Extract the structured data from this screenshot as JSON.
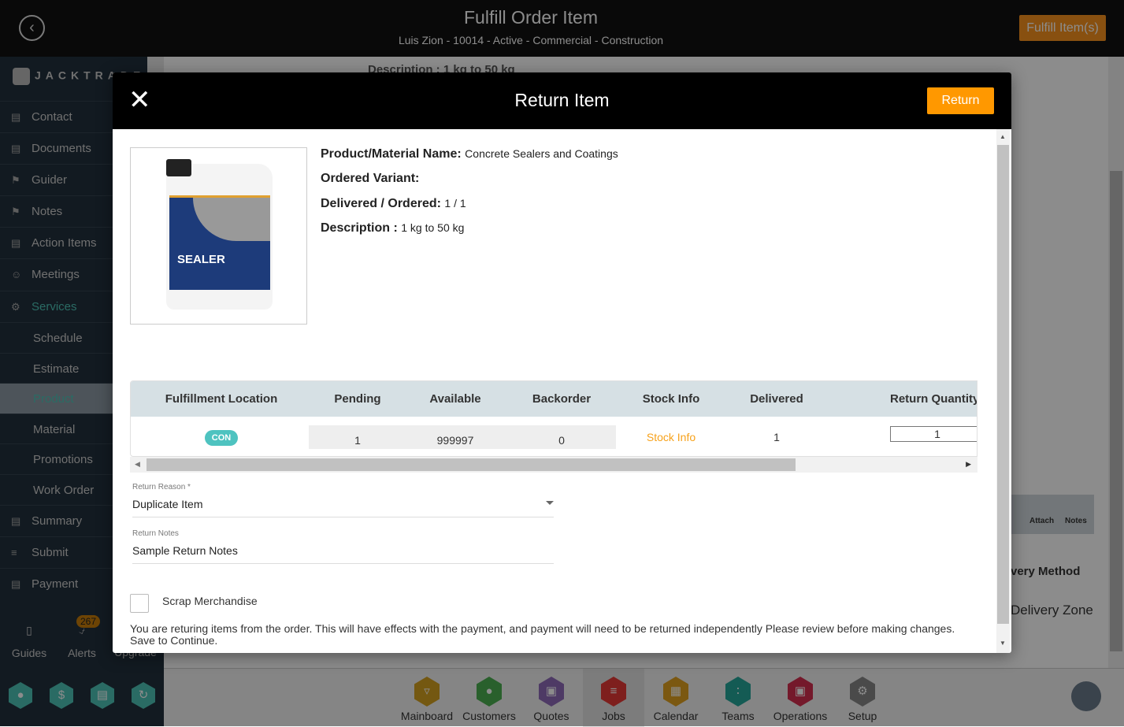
{
  "header": {
    "title": "Fulfill Order Item",
    "subtitle": "Luis Zion - 10014 - Active - Commercial - Construction",
    "fulfill_button": "Fulfill Item(s)"
  },
  "sidebar": {
    "logo": "JACKTRADE",
    "items": [
      {
        "label": "Contact",
        "icon": "contact-book-icon"
      },
      {
        "label": "Documents",
        "icon": "document-icon"
      },
      {
        "label": "Guider",
        "icon": "signpost-icon"
      },
      {
        "label": "Notes",
        "icon": "signpost-icon"
      },
      {
        "label": "Action Items",
        "icon": "clipboard-icon"
      },
      {
        "label": "Meetings",
        "icon": "meeting-icon"
      },
      {
        "label": "Services",
        "icon": "services-icon",
        "active": true
      },
      {
        "label": "Schedule"
      },
      {
        "label": "Estimate"
      },
      {
        "label": "Product",
        "selected": true
      },
      {
        "label": "Material"
      },
      {
        "label": "Promotions"
      },
      {
        "label": "Work Order"
      },
      {
        "label": "Summary",
        "icon": "summary-icon"
      },
      {
        "label": "Submit",
        "icon": "submit-icon"
      },
      {
        "label": "Payment",
        "icon": "payment-icon"
      }
    ],
    "bottom": {
      "guides": "Guides",
      "alerts": "Alerts",
      "alerts_count": "267",
      "upgrade": "Upgrade"
    }
  },
  "background": {
    "description": "Description : 1 kg to 50 kg",
    "attach": "Attach",
    "notes": "Notes",
    "delivery_method": "very Method",
    "delivery_zone": "Delivery Zone"
  },
  "bottom_nav": [
    {
      "label": "Mainboard",
      "color": "#d4a020"
    },
    {
      "label": "Customers",
      "color": "#4caf50"
    },
    {
      "label": "Quotes",
      "color": "#8e6bb8"
    },
    {
      "label": "Jobs",
      "color": "#e53935",
      "selected": true
    },
    {
      "label": "Calendar",
      "color": "#e0a020"
    },
    {
      "label": "Teams",
      "color": "#26a69a"
    },
    {
      "label": "Operations",
      "color": "#d32f4f"
    },
    {
      "label": "Setup",
      "color": "#888888"
    }
  ],
  "modal": {
    "title": "Return Item",
    "return_button": "Return",
    "product": {
      "name_label": "Product/Material Name:",
      "name": "Concrete Sealers and Coatings",
      "variant_label": "Ordered Variant:",
      "variant": "",
      "delivered_label": "Delivered / Ordered:",
      "delivered": "1 / 1",
      "description_label": "Description :",
      "description": "1 kg to 50 kg",
      "image_text": "Concrete SEALER"
    },
    "table": {
      "headers": [
        "Fulfillment Location",
        "Pending",
        "Available",
        "Backorder",
        "Stock Info",
        "Delivered",
        "Return Quantity"
      ],
      "row": {
        "location": "CON",
        "pending": "1",
        "available": "999997",
        "backorder": "0",
        "stock_info": "Stock Info",
        "delivered": "1",
        "return_quantity": "1"
      }
    },
    "return_reason": {
      "label": "Return Reason *",
      "value": "Duplicate Item"
    },
    "return_notes": {
      "label": "Return Notes",
      "value": "Sample Return Notes"
    },
    "scrap": {
      "label": "Scrap Merchandise",
      "checked": false
    },
    "warning": "You are returing items from the order. This will have effects with the payment, and payment will need to be returned independently Please review before making changes. Save to Continue."
  },
  "colors": {
    "accent": "#ff9800",
    "teal": "#4ec3b6"
  }
}
